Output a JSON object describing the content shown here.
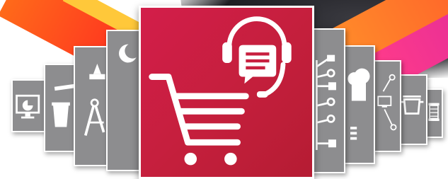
{
  "banner": {
    "colors": {
      "main_tile": "#c8203f",
      "tile_gray": "#8d8d8f",
      "stripe_orange": "#ff5a1f",
      "stripe_yellow": "#ffc83a",
      "stripe_pink": "#e02a9a",
      "icon": "#ffffff"
    },
    "featured_tile": {
      "icons": [
        "shopping-cart-icon",
        "headset-icon",
        "chat-bubble-icon"
      ]
    },
    "left_tiles": [
      {
        "icon": "monitor-chart-icon"
      },
      {
        "icon": "paint-bucket-icon"
      },
      {
        "icon": "drafting-compass-icon"
      },
      {
        "icon": "hammer-icon"
      },
      {
        "icon": "moon-icon"
      }
    ],
    "right_tiles": [
      {
        "icon": "circuit-icon"
      },
      {
        "icon": "chef-hat-icon"
      },
      {
        "icon": "network-icon"
      },
      {
        "icon": "cooking-pot-icon"
      },
      {
        "icon": "thread-spool-icon"
      }
    ]
  }
}
